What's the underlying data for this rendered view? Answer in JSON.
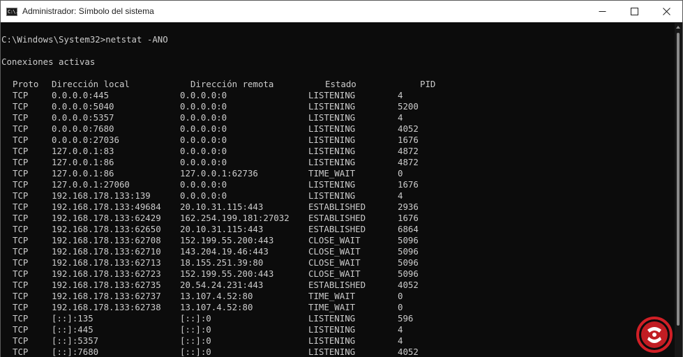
{
  "window": {
    "title": "Administrador: Símbolo del sistema",
    "icon": "cmd-icon",
    "icon_glyph": "C:\\.",
    "controls": [
      "minimize-icon",
      "maximize-icon",
      "close-icon"
    ]
  },
  "terminal": {
    "prompt": "C:\\Windows\\System32>netstat -ANO",
    "heading": "Conexiones activas",
    "columns": [
      "Proto",
      "Dirección local",
      "Dirección remota",
      "Estado",
      "PID"
    ],
    "rows": [
      [
        "TCP",
        "0.0.0.0:445",
        "0.0.0.0:0",
        "LISTENING",
        "4"
      ],
      [
        "TCP",
        "0.0.0.0:5040",
        "0.0.0.0:0",
        "LISTENING",
        "5200"
      ],
      [
        "TCP",
        "0.0.0.0:5357",
        "0.0.0.0:0",
        "LISTENING",
        "4"
      ],
      [
        "TCP",
        "0.0.0.0:7680",
        "0.0.0.0:0",
        "LISTENING",
        "4052"
      ],
      [
        "TCP",
        "0.0.0.0:27036",
        "0.0.0.0:0",
        "LISTENING",
        "1676"
      ],
      [
        "TCP",
        "127.0.0.1:83",
        "0.0.0.0:0",
        "LISTENING",
        "4872"
      ],
      [
        "TCP",
        "127.0.0.1:86",
        "0.0.0.0:0",
        "LISTENING",
        "4872"
      ],
      [
        "TCP",
        "127.0.0.1:86",
        "127.0.0.1:62736",
        "TIME_WAIT",
        "0"
      ],
      [
        "TCP",
        "127.0.0.1:27060",
        "0.0.0.0:0",
        "LISTENING",
        "1676"
      ],
      [
        "TCP",
        "192.168.178.133:139",
        "0.0.0.0:0",
        "LISTENING",
        "4"
      ],
      [
        "TCP",
        "192.168.178.133:49684",
        "20.10.31.115:443",
        "ESTABLISHED",
        "2936"
      ],
      [
        "TCP",
        "192.168.178.133:62429",
        "162.254.199.181:27032",
        "ESTABLISHED",
        "1676"
      ],
      [
        "TCP",
        "192.168.178.133:62650",
        "20.10.31.115:443",
        "ESTABLISHED",
        "6864"
      ],
      [
        "TCP",
        "192.168.178.133:62708",
        "152.199.55.200:443",
        "CLOSE_WAIT",
        "5096"
      ],
      [
        "TCP",
        "192.168.178.133:62710",
        "143.204.19.46:443",
        "CLOSE_WAIT",
        "5096"
      ],
      [
        "TCP",
        "192.168.178.133:62713",
        "18.155.251.39:80",
        "CLOSE_WAIT",
        "5096"
      ],
      [
        "TCP",
        "192.168.178.133:62723",
        "152.199.55.200:443",
        "CLOSE_WAIT",
        "5096"
      ],
      [
        "TCP",
        "192.168.178.133:62735",
        "20.54.24.231:443",
        "ESTABLISHED",
        "4052"
      ],
      [
        "TCP",
        "192.168.178.133:62737",
        "13.107.4.52:80",
        "TIME_WAIT",
        "0"
      ],
      [
        "TCP",
        "192.168.178.133:62738",
        "13.107.4.52:80",
        "TIME_WAIT",
        "0"
      ],
      [
        "TCP",
        "[::]:135",
        "[::]:0",
        "LISTENING",
        "596"
      ],
      [
        "TCP",
        "[::]:445",
        "[::]:0",
        "LISTENING",
        "4"
      ],
      [
        "TCP",
        "[::]:5357",
        "[::]:0",
        "LISTENING",
        "4"
      ],
      [
        "TCP",
        "[::]:7680",
        "[::]:0",
        "LISTENING",
        "4052"
      ]
    ]
  },
  "colors": {
    "background": "#0c0c0c",
    "text": "#cccccc",
    "titlebar": "#ffffff",
    "watermark_red": "#d11f26"
  },
  "watermark": {
    "icon": "logo-icon"
  }
}
